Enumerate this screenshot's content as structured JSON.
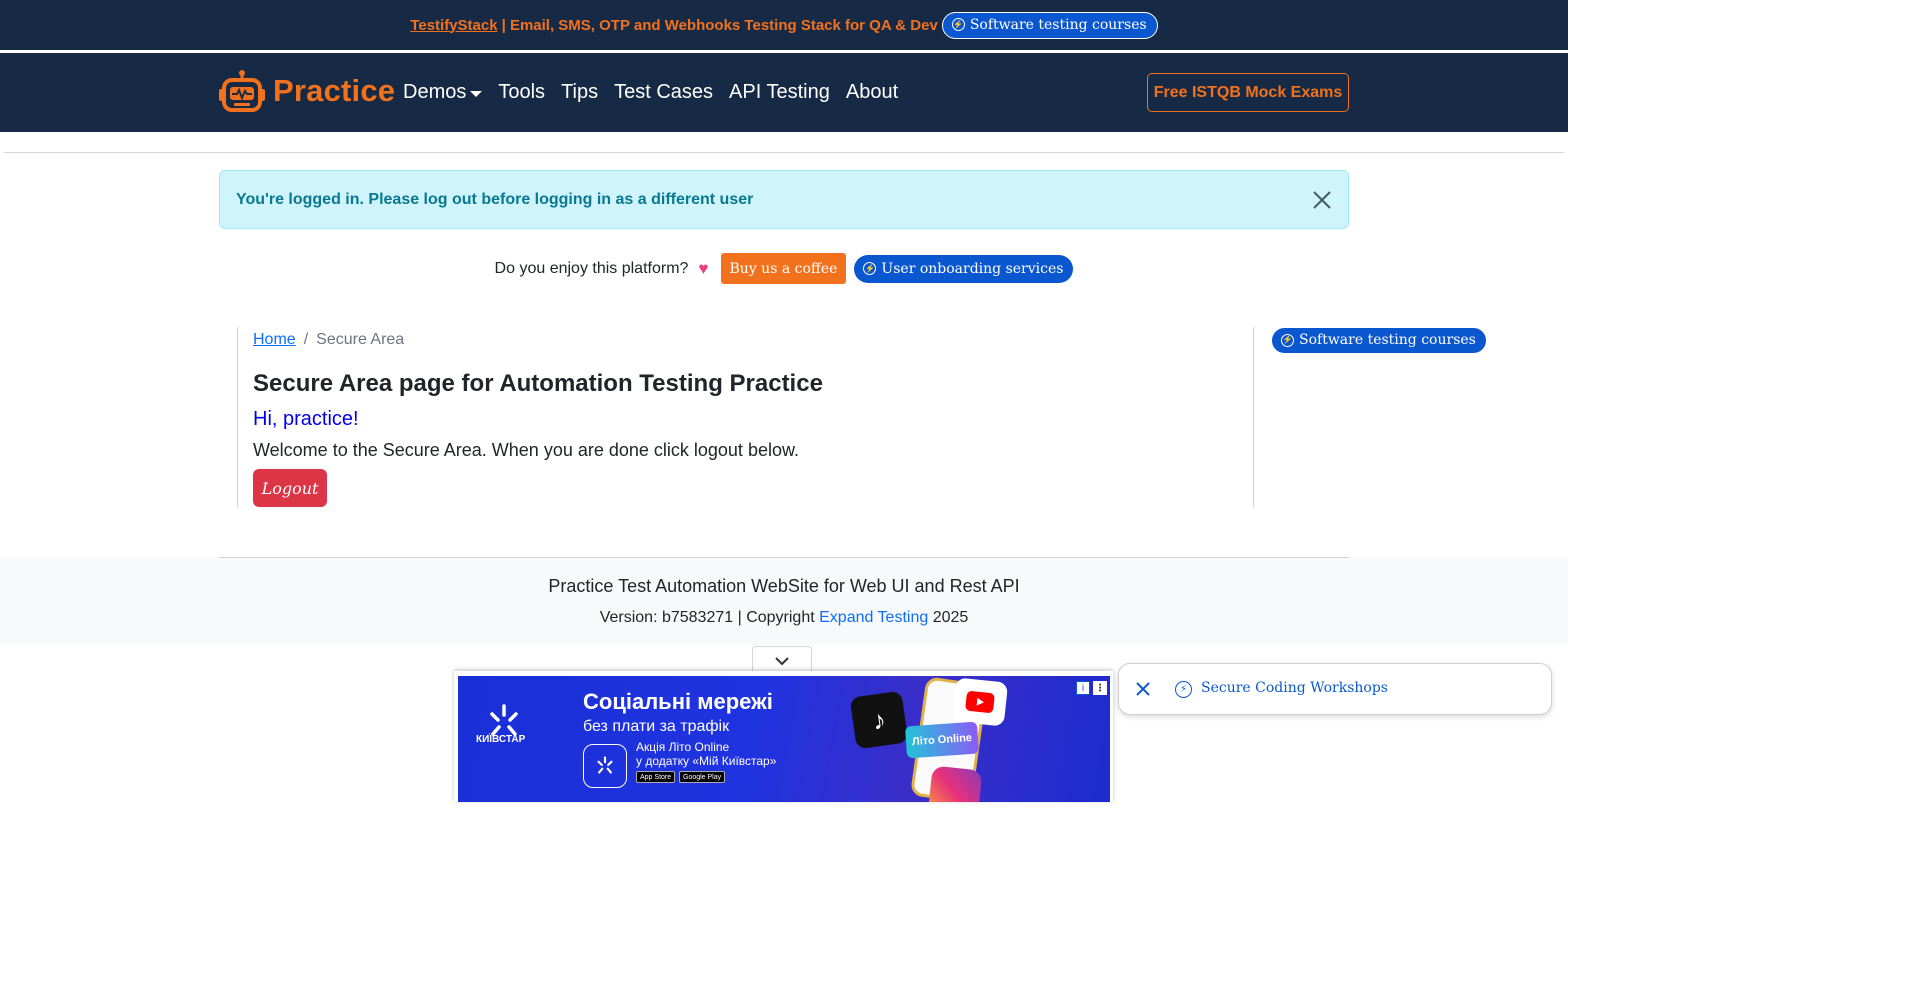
{
  "promo_bar": {
    "link": "TestifyStack",
    "text": " | Email, SMS, OTP and Webhooks Testing Stack for QA & Dev",
    "pill_label": "Software testing courses"
  },
  "navbar": {
    "brand": "Practice",
    "items": [
      {
        "label": "Demos",
        "has_dropdown": true
      },
      {
        "label": "Tools"
      },
      {
        "label": "Tips"
      },
      {
        "label": "Test Cases"
      },
      {
        "label": "API Testing"
      },
      {
        "label": "About"
      }
    ],
    "cta": "Free ISTQB Mock Exams"
  },
  "alert": {
    "text": "You're logged in. Please log out before logging in as a different user"
  },
  "enjoy": {
    "question": "Do you enjoy this platform?",
    "coffee_button": "Buy us a coffee",
    "onboarding_pill": "User onboarding services"
  },
  "breadcrumb": {
    "home": "Home",
    "separator": "/",
    "current": "Secure Area"
  },
  "main": {
    "title": "Secure Area page for Automation Testing Practice",
    "greeting": "Hi, practice!",
    "welcome": "Welcome to the Secure Area. When you are done click logout below.",
    "logout_button": "Logout"
  },
  "sidebar": {
    "pill_label": "Software testing courses"
  },
  "footer": {
    "title": "Practice Test Automation WebSite for Web UI and Rest API",
    "version_prefix": "Version: b7583271 | Copyright ",
    "company_link": "Expand Testing",
    "year": " 2025"
  },
  "ad": {
    "brand": "КИЇВСТАР",
    "headline": "Соціальні мережі",
    "subline": "без плати за трафік",
    "promo_line1": "Акція Літо Online",
    "promo_line2": "у додатку «Мій Київстар»",
    "store1": "App Store",
    "store2": "Google Play",
    "sticker": "Літо Online"
  },
  "toast": {
    "label": "Secure Coding Workshops"
  },
  "colors": {
    "navy": "#172a45",
    "orange": "#f2711c",
    "pill_blue": "#0b57d0",
    "alert_bg": "#cff4fc",
    "alert_text": "#087990",
    "danger": "#dc3545",
    "link": "#0d6efd"
  }
}
